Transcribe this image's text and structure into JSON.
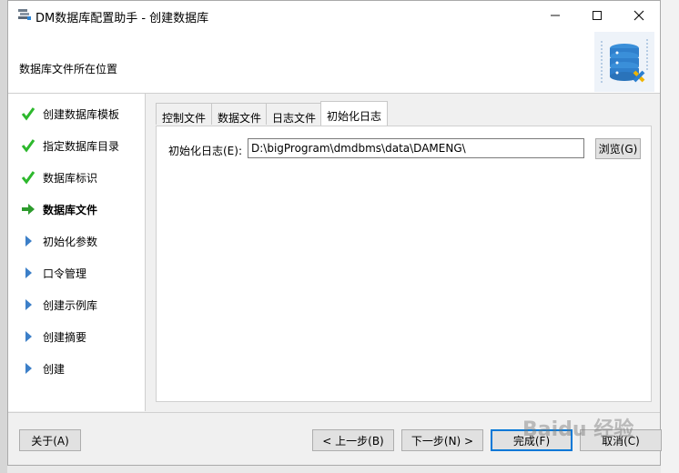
{
  "window": {
    "title": "DM数据库配置助手 - 创建数据库"
  },
  "header": {
    "title": "数据库文件所在位置"
  },
  "steps": [
    {
      "label": "创建数据库模板",
      "status": "done"
    },
    {
      "label": "指定数据库目录",
      "status": "done"
    },
    {
      "label": "数据库标识",
      "status": "done"
    },
    {
      "label": "数据库文件",
      "status": "current"
    },
    {
      "label": "初始化参数",
      "status": "pending"
    },
    {
      "label": "口令管理",
      "status": "pending"
    },
    {
      "label": "创建示例库",
      "status": "pending"
    },
    {
      "label": "创建摘要",
      "status": "pending"
    },
    {
      "label": "创建",
      "status": "pending"
    }
  ],
  "tabs": [
    {
      "label": "控制文件"
    },
    {
      "label": "数据文件"
    },
    {
      "label": "日志文件"
    },
    {
      "label": "初始化日志"
    }
  ],
  "form": {
    "init_log_label": "初始化日志(E):",
    "init_log_path": "D:\\bigProgram\\dmdbms\\data\\DAMENG\\",
    "browse_label": "浏览(G)"
  },
  "footer": {
    "about_label": "关于(A)",
    "prev_label": "< 上一步(B)",
    "next_label": "下一步(N) >",
    "finish_label": "完成(F)",
    "cancel_label": "取消(C)"
  },
  "watermark": {
    "text": "Baidu 经验"
  },
  "colors": {
    "check": "#2db82d",
    "arrow": "#2d9b2d",
    "pending": "#3c7fc8",
    "accent": "#0078d7"
  }
}
